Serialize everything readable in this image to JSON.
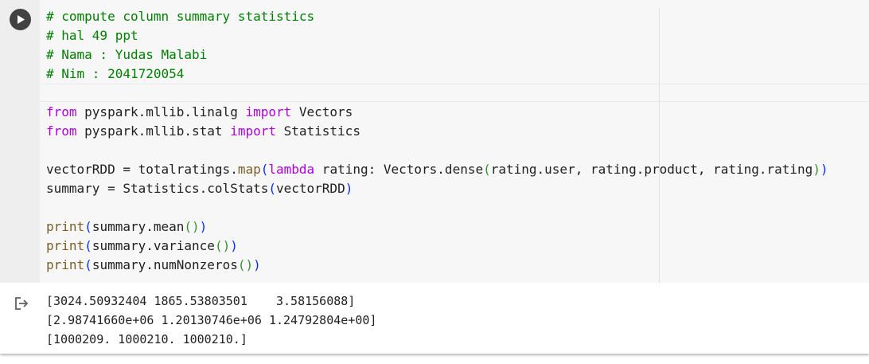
{
  "cell": {
    "run_icon": "play-icon",
    "output_icon": "output-arrow-icon",
    "code": {
      "line1": "# compute column summary statistics",
      "line2": "# hal 49 ppt",
      "line3": "# Nama : Yudas Malabi",
      "line4": "# Nim : 2041720054",
      "line6": {
        "kw1": "from",
        "mod": " pyspark.mllib.linalg ",
        "kw2": "import",
        "name": " Vectors"
      },
      "line7": {
        "kw1": "from",
        "mod": " pyspark.mllib.stat ",
        "kw2": "import",
        "name": " Statistics"
      },
      "line9": {
        "lhs": "vectorRDD = totalratings.",
        "fn": "map",
        "kw": "lambda",
        "body": " rating: Vectors.dense",
        "args": "rating.user, rating.product, rating.rating"
      },
      "line10": {
        "lhs": "summary = Statistics.colStats",
        "args": "vectorRDD"
      },
      "line12": {
        "fn": "print",
        "mid": "summary.mean"
      },
      "line13": {
        "fn": "print",
        "mid": "summary.variance"
      },
      "line14": {
        "fn": "print",
        "mid": "summary.numNonzeros"
      }
    },
    "output": {
      "lines": [
        "[3024.50932404 1865.53803501    3.58156088]",
        "[2.98741660e+06 1.20130746e+06 1.24792804e+00]",
        "[1000209. 1000210. 1000210.]"
      ]
    }
  }
}
